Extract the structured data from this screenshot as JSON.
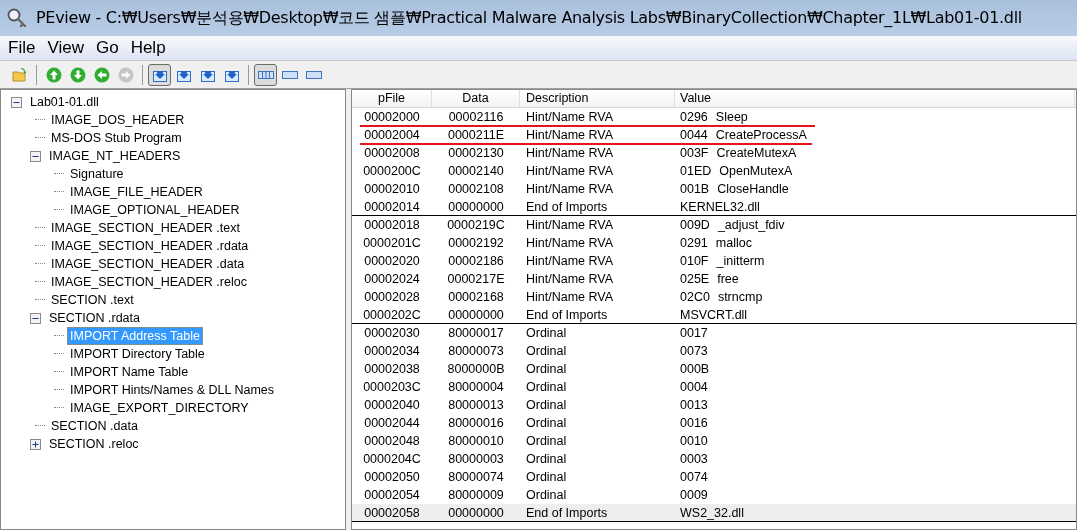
{
  "window": {
    "title": "PEview - C:₩Users₩분석용₩Desktop₩코드 샘플₩Practical Malware Analysis Labs₩BinaryCollection₩Chapter_1L₩Lab01-01.dll"
  },
  "menu": [
    "File",
    "View",
    "Go",
    "Help"
  ],
  "toolbar": [
    {
      "kind": "open",
      "selected": false,
      "disabled": false
    },
    {
      "kind": "sep"
    },
    {
      "kind": "up",
      "selected": false,
      "disabled": false
    },
    {
      "kind": "down",
      "selected": false,
      "disabled": false
    },
    {
      "kind": "back",
      "selected": false,
      "disabled": false
    },
    {
      "kind": "forward",
      "selected": false,
      "disabled": true
    },
    {
      "kind": "sep"
    },
    {
      "kind": "view",
      "selected": true,
      "disabled": false
    },
    {
      "kind": "view",
      "selected": false,
      "disabled": false
    },
    {
      "kind": "view",
      "selected": false,
      "disabled": false
    },
    {
      "kind": "view",
      "selected": false,
      "disabled": false
    },
    {
      "kind": "sep"
    },
    {
      "kind": "layout",
      "selected": true,
      "disabled": false
    },
    {
      "kind": "layout",
      "selected": false,
      "disabled": false
    },
    {
      "kind": "layout",
      "selected": false,
      "disabled": false
    }
  ],
  "tree": [
    {
      "label": "Lab01-01.dll",
      "expanded": true,
      "selected": false,
      "children": [
        {
          "label": "IMAGE_DOS_HEADER",
          "selected": false
        },
        {
          "label": "MS-DOS Stub Program",
          "selected": false
        },
        {
          "label": "IMAGE_NT_HEADERS",
          "expanded": true,
          "selected": false,
          "children": [
            {
              "label": "Signature",
              "selected": false
            },
            {
              "label": "IMAGE_FILE_HEADER",
              "selected": false
            },
            {
              "label": "IMAGE_OPTIONAL_HEADER",
              "selected": false
            }
          ]
        },
        {
          "label": "IMAGE_SECTION_HEADER .text",
          "selected": false
        },
        {
          "label": "IMAGE_SECTION_HEADER .rdata",
          "selected": false
        },
        {
          "label": "IMAGE_SECTION_HEADER .data",
          "selected": false
        },
        {
          "label": "IMAGE_SECTION_HEADER .reloc",
          "selected": false
        },
        {
          "label": "SECTION .text",
          "selected": false
        },
        {
          "label": "SECTION .rdata",
          "expanded": true,
          "selected": false,
          "children": [
            {
              "label": "IMPORT Address Table",
              "selected": true
            },
            {
              "label": "IMPORT Directory Table",
              "selected": false
            },
            {
              "label": "IMPORT Name Table",
              "selected": false
            },
            {
              "label": "IMPORT Hints/Names & DLL Names",
              "selected": false
            },
            {
              "label": "IMAGE_EXPORT_DIRECTORY",
              "selected": false
            }
          ]
        },
        {
          "label": "SECTION .data",
          "selected": false
        },
        {
          "label": "SECTION .reloc",
          "expanded": false,
          "selected": false
        }
      ]
    }
  ],
  "table": {
    "columns": [
      "pFile",
      "Data",
      "Description",
      "Value"
    ],
    "rows": [
      {
        "pfile": "00002000",
        "data": "00002116",
        "description": "Hint/Name RVA",
        "value": "0296",
        "name": "Sleep",
        "underlined": true,
        "selected": false,
        "group_end": false
      },
      {
        "pfile": "00002004",
        "data": "0000211E",
        "description": "Hint/Name RVA",
        "value": "0044",
        "name": "CreateProcessA",
        "underlined": true,
        "selected": false,
        "group_end": false
      },
      {
        "pfile": "00002008",
        "data": "00002130",
        "description": "Hint/Name RVA",
        "value": "003F",
        "name": "CreateMutexA",
        "underlined": false,
        "selected": false,
        "group_end": false
      },
      {
        "pfile": "0000200C",
        "data": "00002140",
        "description": "Hint/Name RVA",
        "value": "01ED",
        "name": "OpenMutexA",
        "underlined": false,
        "selected": false,
        "group_end": false
      },
      {
        "pfile": "00002010",
        "data": "00002108",
        "description": "Hint/Name RVA",
        "value": "001B",
        "name": "CloseHandle",
        "underlined": false,
        "selected": false,
        "group_end": false
      },
      {
        "pfile": "00002014",
        "data": "00000000",
        "description": "End of Imports",
        "value": "KERNEL32.dll",
        "underlined": false,
        "selected": false,
        "group_end": true
      },
      {
        "pfile": "00002018",
        "data": "0000219C",
        "description": "Hint/Name RVA",
        "value": "009D",
        "name": "_adjust_fdiv",
        "underlined": false,
        "selected": false,
        "group_end": false
      },
      {
        "pfile": "0000201C",
        "data": "00002192",
        "description": "Hint/Name RVA",
        "value": "0291",
        "name": "malloc",
        "underlined": false,
        "selected": false,
        "group_end": false
      },
      {
        "pfile": "00002020",
        "data": "00002186",
        "description": "Hint/Name RVA",
        "value": "010F",
        "name": "_initterm",
        "underlined": false,
        "selected": false,
        "group_end": false
      },
      {
        "pfile": "00002024",
        "data": "0000217E",
        "description": "Hint/Name RVA",
        "value": "025E",
        "name": "free",
        "underlined": false,
        "selected": false,
        "group_end": false
      },
      {
        "pfile": "00002028",
        "data": "00002168",
        "description": "Hint/Name RVA",
        "value": "02C0",
        "name": "strncmp",
        "underlined": false,
        "selected": false,
        "group_end": false
      },
      {
        "pfile": "0000202C",
        "data": "00000000",
        "description": "End of Imports",
        "value": "MSVCRT.dll",
        "underlined": false,
        "selected": false,
        "group_end": true
      },
      {
        "pfile": "00002030",
        "data": "80000017",
        "description": "Ordinal",
        "value": "0017",
        "underlined": false,
        "selected": false,
        "group_end": false
      },
      {
        "pfile": "00002034",
        "data": "80000073",
        "description": "Ordinal",
        "value": "0073",
        "underlined": false,
        "selected": false,
        "group_end": false
      },
      {
        "pfile": "00002038",
        "data": "8000000B",
        "description": "Ordinal",
        "value": "000B",
        "underlined": false,
        "selected": false,
        "group_end": false
      },
      {
        "pfile": "0000203C",
        "data": "80000004",
        "description": "Ordinal",
        "value": "0004",
        "underlined": false,
        "selected": false,
        "group_end": false
      },
      {
        "pfile": "00002040",
        "data": "80000013",
        "description": "Ordinal",
        "value": "0013",
        "underlined": false,
        "selected": false,
        "group_end": false
      },
      {
        "pfile": "00002044",
        "data": "80000016",
        "description": "Ordinal",
        "value": "0016",
        "underlined": false,
        "selected": false,
        "group_end": false
      },
      {
        "pfile": "00002048",
        "data": "80000010",
        "description": "Ordinal",
        "value": "0010",
        "underlined": false,
        "selected": false,
        "group_end": false
      },
      {
        "pfile": "0000204C",
        "data": "80000003",
        "description": "Ordinal",
        "value": "0003",
        "underlined": false,
        "selected": false,
        "group_end": false
      },
      {
        "pfile": "00002050",
        "data": "80000074",
        "description": "Ordinal",
        "value": "0074",
        "underlined": false,
        "selected": false,
        "group_end": false
      },
      {
        "pfile": "00002054",
        "data": "80000009",
        "description": "Ordinal",
        "value": "0009",
        "underlined": false,
        "selected": false,
        "group_end": false
      },
      {
        "pfile": "00002058",
        "data": "00000000",
        "description": "End of Imports",
        "value": "WS2_32.dll",
        "underlined": false,
        "selected": true,
        "group_end": true
      }
    ]
  }
}
